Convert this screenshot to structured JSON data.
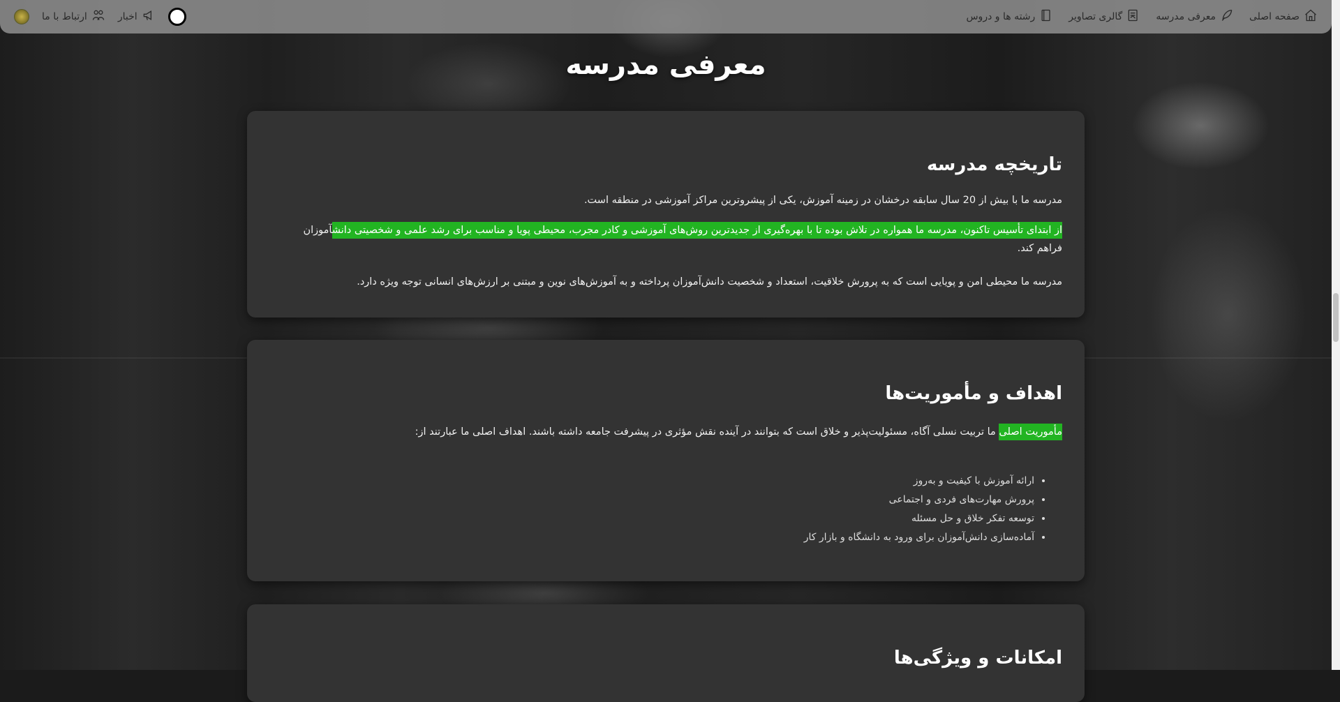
{
  "nav": {
    "items": [
      {
        "label": "صفحه اصلی",
        "icon": "home-icon"
      },
      {
        "label": "معرفی مدرسه",
        "icon": "feather-icon"
      },
      {
        "label": "گالری تصاویر",
        "icon": "gallery-icon"
      },
      {
        "label": "رشته ها و دروس",
        "icon": "book-icon"
      }
    ],
    "news_label": "اخبار",
    "contact_label": "ارتباط با ما"
  },
  "page_title": "معرفی مدرسه",
  "history": {
    "heading": "تاریخچه مدرسه",
    "p1": "مدرسه ما با بیش از 20 سال سابقه درخشان در زمینه آموزش، یکی از پیشروترین مراکز آموزشی در منطقه است.",
    "p2_highlight": "از ابتدای تأسیس تاکنون، مدرسه ما همواره در تلاش بوده تا با بهره‌گیری از جدیدترین روش‌های آموزشی و کادر مجرب، محیطی پویا و مناسب برای رشد علمی و شخصیتی دانش",
    "p2_rest": "آموزان فراهم کند.",
    "p3": "مدرسه ما محیطی امن و پویایی است که به پرورش خلاقیت، استعداد و شخصیت دانش‌آموزان پرداخته و به آموزش‌های نوین و مبتنی بر ارزش‌های انسانی توجه ویژه دارد."
  },
  "goals": {
    "heading": "اهداف و مأموریت‌ها",
    "p1_highlight": "مأموریت اصلی",
    "p1_rest": " ما تربیت نسلی آگاه، مسئولیت‌پذیر و خلاق است که بتوانند در آینده نقش مؤثری در پیشرفت جامعه داشته باشند. اهداف اصلی ما عبارتند از:",
    "list": [
      "ارائه آموزش با کیفیت و به‌روز",
      "پرورش مهارت‌های فردی و اجتماعی",
      "توسعه تفکر خلاق و حل مسئله",
      "آماده‌سازی دانش‌آموزان برای ورود به دانشگاه و بازار کار"
    ]
  },
  "features": {
    "heading": "امکانات و ویژگی‌ها"
  }
}
